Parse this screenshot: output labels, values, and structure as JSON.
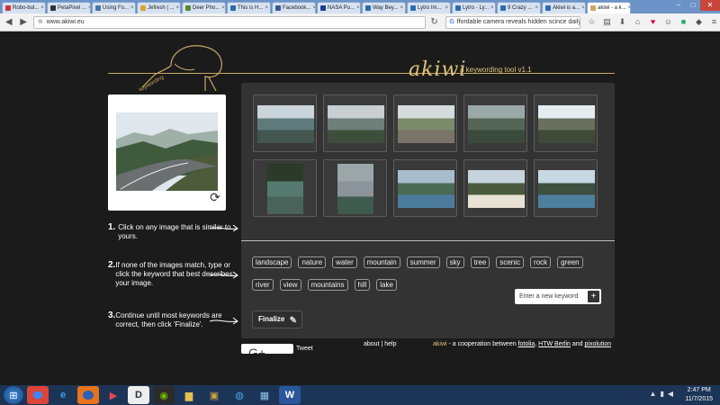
{
  "browser": {
    "tabs": [
      {
        "label": "Robo-bul...",
        "color": "#c33"
      },
      {
        "label": "PetaPixel ...",
        "color": "#333"
      },
      {
        "label": "Using Fo...",
        "color": "#4477aa"
      },
      {
        "label": "Jefresh | ...",
        "color": "#d8a431"
      },
      {
        "label": "Deer Pho...",
        "color": "#558833"
      },
      {
        "label": "This is H...",
        "color": "#2b6cb0"
      },
      {
        "label": "Facebook...",
        "color": "#3b5998"
      },
      {
        "label": "NASA Pu...",
        "color": "#1c3f95"
      },
      {
        "label": "Way Bey...",
        "color": "#2b6cb0"
      },
      {
        "label": "Lytro Im...",
        "color": "#2b6cb0"
      },
      {
        "label": "Lytro - Ly...",
        "color": "#2b6cb0"
      },
      {
        "label": "9 Crazy ...",
        "color": "#2b6cb0"
      },
      {
        "label": "Akiwi is a...",
        "color": "#2b6cb0"
      },
      {
        "label": "akiwi - a k...",
        "color": "#c8a865"
      }
    ],
    "active_tab_index": 13,
    "url": "www.akiwi.eu",
    "search_text": "ffordable camera  reveals hidden scince daily",
    "window_controls": [
      "–",
      "□",
      "✕"
    ]
  },
  "header": {
    "brand": "akiwi",
    "tagline": "a keywording tool v1.1",
    "logo_text": "keywording"
  },
  "query_image": {
    "refresh_icon": "refresh-icon"
  },
  "steps": [
    {
      "num": "1.",
      "text": "Click on any image that is similar to yours."
    },
    {
      "num": "2.",
      "text": "If none of the images match, type or click the keyword that best describes your image."
    },
    {
      "num": "3.",
      "text": "Continue until most keywords are correct, then click 'Finalize'."
    }
  ],
  "thumbnails": [
    {
      "sky": "#c9d5da",
      "mid": "#5f7a7a",
      "ground": "#42554f"
    },
    {
      "sky": "#c7cfd2",
      "mid": "#6d7f78",
      "ground": "#3d4f3b"
    },
    {
      "sky": "#d6dcde",
      "mid": "#7c8a6c",
      "ground": "#7a7468"
    },
    {
      "sky": "#9aa8a8",
      "mid": "#556659",
      "ground": "#3a4a3c"
    },
    {
      "sky": "#e4ecf0",
      "mid": "#6a7060",
      "ground": "#3f4a38"
    },
    {
      "sky": "#2c3a2a",
      "mid": "#55796e",
      "ground": "#49635a"
    },
    {
      "sky": "#9aa6a8",
      "mid": "#8b949a",
      "ground": "#3f5a4e"
    },
    {
      "sky": "#a9bccb",
      "mid": "#4a6a55",
      "ground": "#4c7c9c"
    },
    {
      "sky": "#c7d3dd",
      "mid": "#4a5a3e",
      "ground": "#e7e2d3"
    },
    {
      "sky": "#c7d7e3",
      "mid": "#3d4f3e",
      "ground": "#4d7f9d"
    }
  ],
  "keywords": [
    "landscape",
    "nature",
    "water",
    "mountain",
    "summer",
    "sky",
    "tree",
    "scenic",
    "rock",
    "green",
    "river",
    "view",
    "mountains",
    "hill",
    "lake"
  ],
  "new_keyword_placeholder": "Enter a new keyword",
  "new_keyword_plus": "+",
  "finalize_label": "Finalize",
  "tweet_label": "Tweet",
  "footer": {
    "links": "about | help",
    "akiwi": "akiwi",
    "coop_text": " - a cooperation between ",
    "fotolia": "fotolia",
    "comma": ", ",
    "htw": "HTW Berlin",
    "and": " and ",
    "pixolution": "pixolution"
  },
  "taskbar": {
    "time": "2:47 PM",
    "date": "11/7/2015"
  }
}
